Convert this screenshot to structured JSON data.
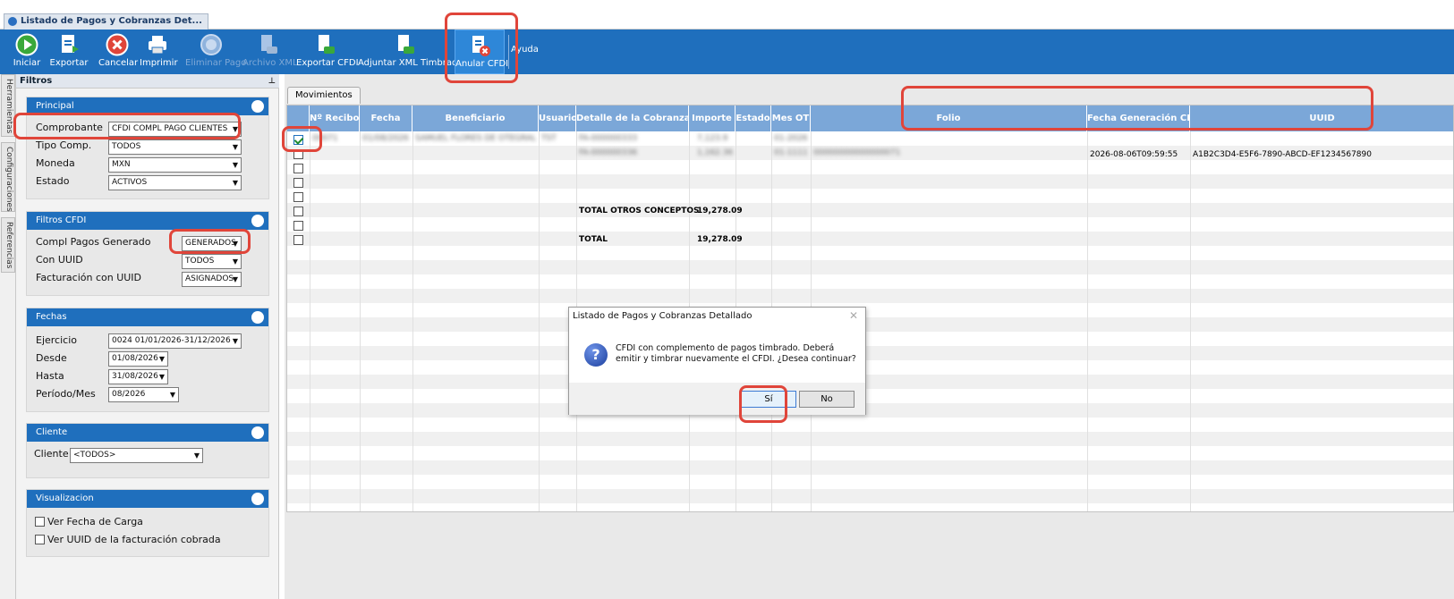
{
  "window": {
    "tab_title": "Listado de Pagos y Cobranzas Det..."
  },
  "toolbar": {
    "buttons": [
      {
        "label": "Iniciar",
        "icon": "play-icon"
      },
      {
        "label": "Exportar",
        "icon": "export-icon"
      },
      {
        "label": "Cancelar",
        "icon": "cancel-icon"
      },
      {
        "label": "Imprimir",
        "icon": "printer-icon"
      },
      {
        "label": "Eliminar Pago",
        "icon": "delete-payment-icon"
      },
      {
        "label": "Archivo XML",
        "icon": "xml-file-icon"
      },
      {
        "label": "Exportar CFDI",
        "icon": "export-cfdi-icon"
      },
      {
        "label": "Adjuntar XML Timbrados",
        "icon": "attach-xml-icon"
      },
      {
        "label": "Anular CFDI",
        "icon": "cancel-cfdi-icon"
      },
      {
        "label": "Ayuda",
        "icon": "help-icon"
      }
    ]
  },
  "side_tabs": [
    "Herramientas",
    "Configuraciones",
    "Referencias"
  ],
  "filters": {
    "title": "Filtros",
    "principal": {
      "title": "Principal",
      "comprobante_label": "Comprobante",
      "comprobante_value": "CFDI COMPL PAGO CLIENTES",
      "tipo_label": "Tipo Comp.",
      "tipo_value": "TODOS",
      "moneda_label": "Moneda",
      "moneda_value": "MXN",
      "estado_label": "Estado",
      "estado_value": "ACTIVOS"
    },
    "cfdi": {
      "title": "Filtros CFDI",
      "compl_label": "Compl Pagos Generado",
      "compl_value": "GENERADOS",
      "uuid_label": "Con UUID",
      "uuid_value": "TODOS",
      "fact_label": "Facturación con UUID",
      "fact_value": "ASIGNADOS"
    },
    "fechas": {
      "title": "Fechas",
      "ejercicio_label": "Ejercicio",
      "ejercicio_value": "0024 01/01/2026-31/12/2026",
      "desde_label": "Desde",
      "desde_value": "01/08/2026",
      "hasta_label": "Hasta",
      "hasta_value": "31/08/2026",
      "periodo_label": "Período/Mes",
      "periodo_value": "08/2026"
    },
    "cliente": {
      "title": "Cliente",
      "label": "Cliente",
      "value": "<TODOS>"
    },
    "visual": {
      "title": "Visualizacion",
      "opt1": "Ver Fecha de Carga",
      "opt2": "Ver UUID de la facturación cobrada"
    }
  },
  "grid": {
    "tab": "Movimientos",
    "columns": [
      "Nº Recibo",
      "Fecha",
      "Beneficiario",
      "Usuario",
      "Detalle de la Cobranza",
      "Importe",
      "Estado",
      "Mes OT",
      "Folio",
      "Fecha Generación CDFI",
      "UUID"
    ],
    "rows": [
      {
        "recibo": "00071",
        "fecha": "01/08/2026",
        "beneficiario": "SAMUEL FLORES DE OTEGRAL",
        "usuario": "TST",
        "detalle": "FA-000000333",
        "importe": "7,123.9",
        "mes": "01-2026"
      },
      {
        "detalle": "FA-000000336",
        "importe": "1,162.36",
        "mes": "01-1111",
        "folio": "00000000000000071",
        "fecha_gen": "2026-08-06T09:59:55",
        "uuid": "A1B2C3D4-E5F6-7890-ABCD-EF1234567890"
      }
    ],
    "total_otros_label": "TOTAL OTROS CONCEPTOS",
    "total_otros_value": "19,278.09",
    "total_label": "TOTAL",
    "total_value": "19,278.09"
  },
  "dialog": {
    "title": "Listado de Pagos y Cobranzas Detallado",
    "message": "CFDI con complemento de pagos timbrado. Deberá emitir y timbrar nuevamente el CFDI. ¿Desea continuar?",
    "yes_label": "Sí",
    "no_label": "No"
  },
  "colors": {
    "toolbar": "#1f6fbd",
    "grid_header": "#7ba7d8",
    "highlight": "#e0453a"
  }
}
